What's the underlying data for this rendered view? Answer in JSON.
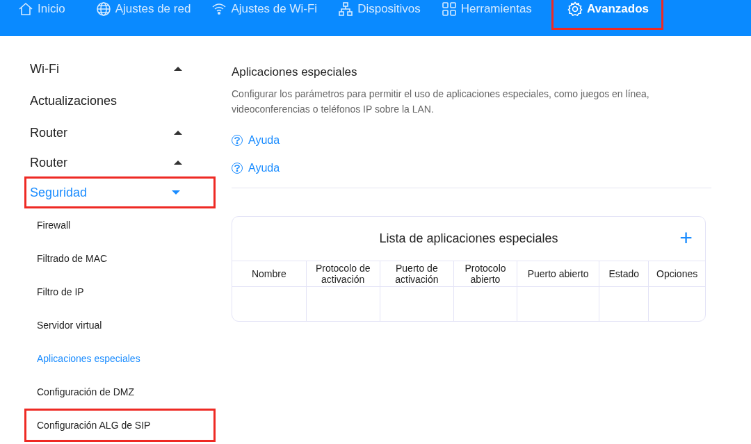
{
  "top_nav": [
    {
      "label": "Inicio",
      "selected": false,
      "highlighted": false
    },
    {
      "label": "Ajustes de red",
      "selected": false,
      "highlighted": false
    },
    {
      "label": "Ajustes de Wi-Fi",
      "selected": false,
      "highlighted": false
    },
    {
      "label": "Dispositivos",
      "selected": false,
      "highlighted": false
    },
    {
      "label": "Herramientas",
      "selected": false,
      "highlighted": false
    },
    {
      "label": "Avanzados",
      "selected": true,
      "highlighted": true
    }
  ],
  "sidebar": {
    "items": [
      {
        "label": "Wi-Fi",
        "kind": "group",
        "expanded": false,
        "highlighted": false
      },
      {
        "label": "Actualizaciones",
        "kind": "link",
        "highlighted": false
      },
      {
        "label": "Router",
        "kind": "group",
        "expanded": false,
        "highlighted": false
      },
      {
        "label": "Router",
        "kind": "group",
        "expanded": false,
        "highlighted": false
      },
      {
        "label": "Seguridad",
        "kind": "group",
        "expanded": true,
        "highlighted": true,
        "children": [
          {
            "label": "Firewall",
            "selected": false,
            "highlighted": false
          },
          {
            "label": "Filtrado de MAC",
            "selected": false,
            "highlighted": false
          },
          {
            "label": "Filtro de IP",
            "selected": false,
            "highlighted": false
          },
          {
            "label": "Servidor virtual",
            "selected": false,
            "highlighted": false
          },
          {
            "label": "Aplicaciones especiales",
            "selected": true,
            "highlighted": false
          },
          {
            "label": "Configuración de DMZ",
            "selected": false,
            "highlighted": false
          },
          {
            "label": "Configuración ALG de SIP",
            "selected": false,
            "highlighted": true
          }
        ]
      }
    ]
  },
  "content": {
    "title": "Aplicaciones especiales",
    "description": "Configurar los parámetros para permitir el uso de aplicaciones especiales, como juegos en línea, videoconferencias o teléfonos IP sobre la LAN.",
    "help_links": [
      "Ayuda",
      "Ayuda"
    ],
    "table": {
      "title": "Lista de aplicaciones especiales",
      "add_button": "+",
      "columns": [
        "Nombre",
        "Protocolo de activación",
        "Puerto de activación",
        "Protocolo abierto",
        "Puerto abierto",
        "Estado",
        "Opciones"
      ]
    }
  }
}
